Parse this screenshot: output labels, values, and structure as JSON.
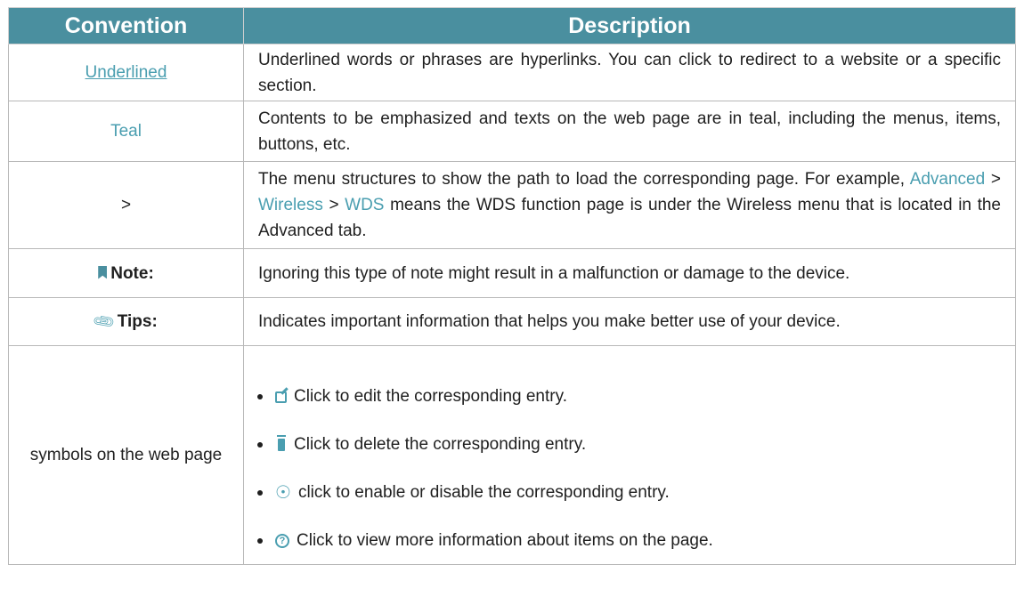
{
  "header": {
    "convention": "Convention",
    "description": "Description"
  },
  "rows": {
    "underlined": {
      "convention": "Underlined",
      "description": "Underlined words or phrases are hyperlinks. You can click to redirect to a website or a specific section."
    },
    "teal": {
      "convention": "Teal",
      "description": "Contents to be emphasized and texts on the web page are in teal, including the menus, items, buttons, etc."
    },
    "arrow": {
      "convention": ">",
      "desc_pre": "The menu structures to show the path to load the corresponding page. For example, ",
      "path1": "Advanced",
      "sep1": " > ",
      "path2": "Wireless",
      "sep2": " > ",
      "path3": "WDS",
      "desc_post": " means the WDS function page is under the Wireless menu that is located in the Advanced tab."
    },
    "note": {
      "icon": "bookmark-icon",
      "convention": "Note:",
      "description": "Ignoring this type of note might result in a malfunction or damage to the device."
    },
    "tips": {
      "icon": "paperclip-icon",
      "convention": "Tips:",
      "description": "Indicates important information that helps you make better use of your device."
    },
    "symbols": {
      "convention": "symbols on the web page",
      "items": [
        {
          "icon": "edit-icon",
          "text": "Click to edit the corresponding entry."
        },
        {
          "icon": "delete-icon",
          "text": "Click to delete the corresponding entry."
        },
        {
          "icon": "lightbulb-icon",
          "text": "click to enable or disable the corresponding entry."
        },
        {
          "icon": "help-icon",
          "text": "Click to view more information about items on the page."
        }
      ]
    }
  },
  "colors": {
    "header_bg": "#4a8f9f",
    "teal": "#4a9eb0"
  }
}
